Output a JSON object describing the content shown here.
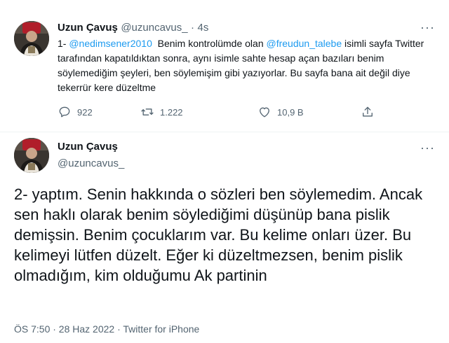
{
  "tweet1": {
    "author_name": "Uzun Çavuş",
    "author_handle": "@uzuncavus_",
    "separator": "·",
    "time": "4s",
    "text_prefix": "1- ",
    "mention1": "@nedimsener2010",
    "text_mid": "  Benim kontrolümde olan ",
    "mention2": "@freudun_talebe",
    "text_rest": " isimli sayfa Twitter tarafından kapatıldıktan sonra, aynı isimle sahte hesap açan bazıları benim söylemediğim şeyleri, ben söylemişim gibi yazıyorlar. Bu sayfa bana ait değil diye tekerrür kere düzeltme",
    "reply_count": "922",
    "retweet_count": "1.222",
    "like_count": "10,9 B",
    "icons": [
      "reply-icon",
      "retweet-icon",
      "like-icon",
      "share-icon",
      "more-icon"
    ]
  },
  "tweet2": {
    "author_name": "Uzun Çavuş",
    "author_handle": "@uzuncavus_",
    "text": "2- yaptım. Senin hakkında o sözleri ben söylemedim. Ancak sen haklı olarak benim söylediğimi düşünüp bana pislik demişsin. Benim çocuklarım var. Bu kelime onları üzer. Bu kelimeyi lütfen düzelt. Eğer ki düzeltmezsen, benim pislik olmadığım, kim olduğumu Ak partinin",
    "footer": "ÖS 7:50 · 28 Haz 2022 · Twitter for iPhone"
  },
  "colors": {
    "link": "#1d9bf0",
    "text": "#0f1419",
    "muted": "#536471",
    "divider": "#eff3f4"
  }
}
